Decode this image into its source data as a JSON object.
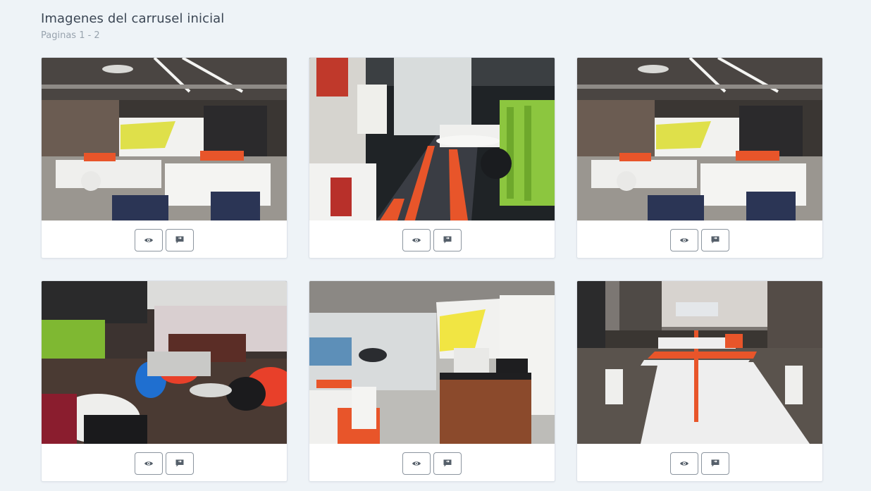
{
  "header": {
    "title": "Imagenes del carrusel inicial",
    "subtitle": "Paginas 1 - 2"
  },
  "cards": [
    {
      "scene": "open-office-refreshment",
      "view_icon": "eye-icon",
      "comment_icon": "comment-icon"
    },
    {
      "scene": "office-corridor-orange-carpet",
      "view_icon": "eye-icon",
      "comment_icon": "comment-icon"
    },
    {
      "scene": "open-office-refreshment",
      "view_icon": "eye-icon",
      "comment_icon": "comment-icon"
    },
    {
      "scene": "lounge-colorful-chairs",
      "view_icon": "eye-icon",
      "comment_icon": "comment-icon"
    },
    {
      "scene": "print-center-area",
      "view_icon": "eye-icon",
      "comment_icon": "comment-icon"
    },
    {
      "scene": "white-desks-orange-divider",
      "view_icon": "eye-icon",
      "comment_icon": "comment-icon"
    }
  ],
  "colors": {
    "background": "#eef3f7",
    "card": "#ffffff",
    "button_border": "#8c959f",
    "icon": "#555f6a",
    "accent_orange": "#e8552a"
  }
}
